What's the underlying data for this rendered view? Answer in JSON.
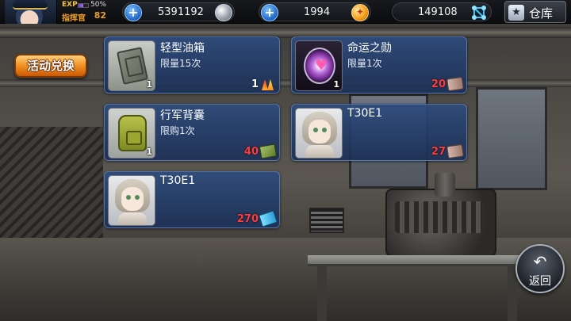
{
  "player": {
    "exp_label": "EXP",
    "exp_percent": "50%",
    "exp_fraction": 0.5,
    "rank_title": "指挥官",
    "level": "82"
  },
  "resources": [
    {
      "name": "silver-coins",
      "value": "5391192",
      "has_plus": true,
      "icon": "silver-coin-icon"
    },
    {
      "name": "gold-coins",
      "value": "1994",
      "has_plus": true,
      "icon": "gold-coin-icon"
    },
    {
      "name": "molecules",
      "value": "149108",
      "has_plus": false,
      "icon": "molecule-icon"
    }
  ],
  "warehouse": {
    "label": "仓库",
    "icon": "star-box-icon"
  },
  "event_button": {
    "label": "活动兑换"
  },
  "items": [
    {
      "name": "轻型油箱",
      "limit": "限量15次",
      "count": "1",
      "price": "1",
      "price_color": "#ffffff",
      "price_icon": "flame-icon",
      "thumb": "fuel-can-icon"
    },
    {
      "name": "命运之勋",
      "limit": "限量1次",
      "count": "1",
      "price": "20",
      "price_color": "#ff3b3b",
      "price_icon": "bullet-icon",
      "thumb": "fate-medal-icon"
    },
    {
      "name": "行军背囊",
      "limit": "限购1次",
      "count": "1",
      "price": "40",
      "price_color": "#ff3b3b",
      "price_icon": "supply-box-icon",
      "thumb": "backpack-icon"
    },
    {
      "name": "T30E1",
      "limit": "",
      "count": "",
      "price": "27",
      "price_color": "#ff3b3b",
      "price_icon": "bullet-icon",
      "thumb": "character-portrait"
    },
    {
      "name": "T30E1",
      "limit": "",
      "count": "",
      "price": "270",
      "price_color": "#ff3b3b",
      "price_icon": "ticket-icon",
      "thumb": "character-portrait"
    }
  ],
  "return_button": {
    "label": "返回",
    "icon": "return-arrow-icon"
  }
}
